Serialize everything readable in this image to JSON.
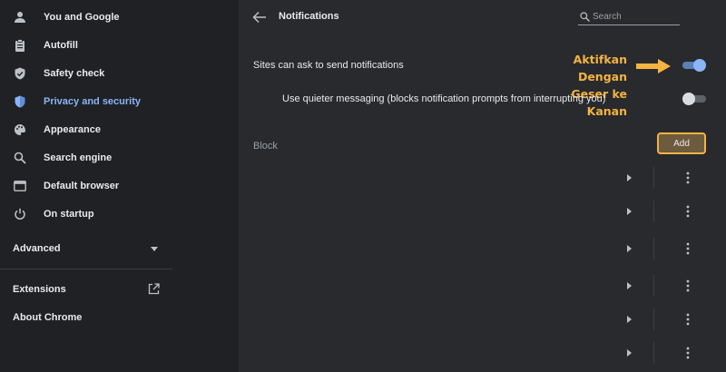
{
  "sidebar": {
    "items": [
      {
        "label": "You and Google",
        "icon": "person-icon"
      },
      {
        "label": "Autofill",
        "icon": "clipboard-icon"
      },
      {
        "label": "Safety check",
        "icon": "shield-check-icon"
      },
      {
        "label": "Privacy and security",
        "icon": "shield-icon",
        "active": true
      },
      {
        "label": "Appearance",
        "icon": "palette-icon"
      },
      {
        "label": "Search engine",
        "icon": "search-icon"
      },
      {
        "label": "Default browser",
        "icon": "browser-icon"
      },
      {
        "label": "On startup",
        "icon": "power-icon"
      }
    ],
    "advanced_label": "Advanced",
    "extensions_label": "Extensions",
    "about_label": "About Chrome"
  },
  "header": {
    "title": "Notifications",
    "search_placeholder": "Search"
  },
  "settings": {
    "sites_can_ask": {
      "label": "Sites can ask to send notifications",
      "enabled": true
    },
    "quieter_messaging": {
      "label": "Use quieter messaging (blocks notification prompts from interrupting you)",
      "enabled": false
    }
  },
  "block": {
    "label": "Block",
    "add_label": "Add",
    "row_count": 6
  },
  "annotation": {
    "line1": "Aktifkan Dengan",
    "line2": "Geser ke Kanan",
    "color": "#f4b342"
  },
  "colors": {
    "accent": "#8ab4f8",
    "background": "#202124",
    "panel": "#292a2d"
  }
}
